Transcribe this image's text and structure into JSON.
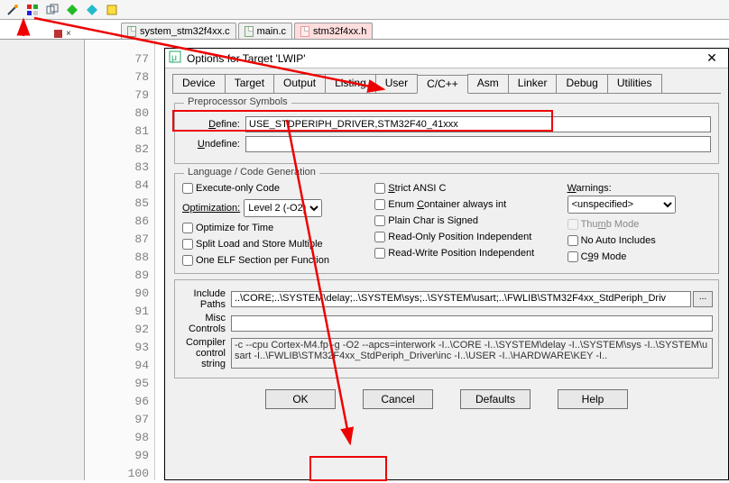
{
  "toolbar": {
    "icons": [
      "wand",
      "target",
      "windows",
      "build",
      "run",
      "debug"
    ]
  },
  "tabs": {
    "files": [
      {
        "name": "system_stm32f4xx.c",
        "kind": "c"
      },
      {
        "name": "main.c",
        "kind": "c"
      },
      {
        "name": "stm32f4xx.h",
        "kind": "h"
      }
    ],
    "activeIndex": 2
  },
  "gutter": {
    "start": 77,
    "end": 100
  },
  "dialog": {
    "title": "Options for Target 'LWIP'",
    "tabs": [
      "Device",
      "Target",
      "Output",
      "Listing",
      "User",
      "C/C++",
      "Asm",
      "Linker",
      "Debug",
      "Utilities"
    ],
    "activeTab": "C/C++",
    "preproc": {
      "group": "Preprocessor Symbols",
      "defineLabel": "Define:",
      "define": "USE_STDPERIPH_DRIVER,STM32F40_41xxx",
      "undefineLabel": "Undefine:",
      "undefine": ""
    },
    "codegen": {
      "group": "Language / Code Generation",
      "col1": {
        "execOnly": "Execute-only Code",
        "optLabel": "Optimization:",
        "optValue": "Level 2 (-O2)",
        "optTime": "Optimize for Time",
        "splitLoad": "Split Load and Store Multiple",
        "oneElf": "One ELF Section per Function"
      },
      "col2": {
        "strictAnsi": "Strict ANSI C",
        "enumInt": "Enum Container always int",
        "plainChar": "Plain Char is Signed",
        "roPos": "Read-Only Position Independent",
        "rwPos": "Read-Write Position Independent"
      },
      "col3": {
        "warnLabel": "Warnings:",
        "warnValue": "<unspecified>",
        "thumb": "Thumb Mode",
        "noAuto": "No Auto Includes",
        "c99": "C99 Mode"
      }
    },
    "paths": {
      "includeLabel": "Include\nPaths",
      "include": "..\\CORE;..\\SYSTEM\\delay;..\\SYSTEM\\sys;..\\SYSTEM\\usart;..\\FWLIB\\STM32F4xx_StdPeriph_Driv",
      "miscLabel": "Misc\nControls",
      "misc": "",
      "compilerLabel": "Compiler\ncontrol\nstring",
      "compiler": "-c --cpu Cortex-M4.fp -g -O2 --apcs=interwork -I..\\CORE -I..\\SYSTEM\\delay -I..\\SYSTEM\\sys -I..\\SYSTEM\\usart -I..\\FWLIB\\STM32F4xx_StdPeriph_Driver\\inc -I..\\USER -I..\\HARDWARE\\KEY -I.."
    },
    "buttons": {
      "ok": "OK",
      "cancel": "Cancel",
      "defaults": "Defaults",
      "help": "Help"
    }
  }
}
